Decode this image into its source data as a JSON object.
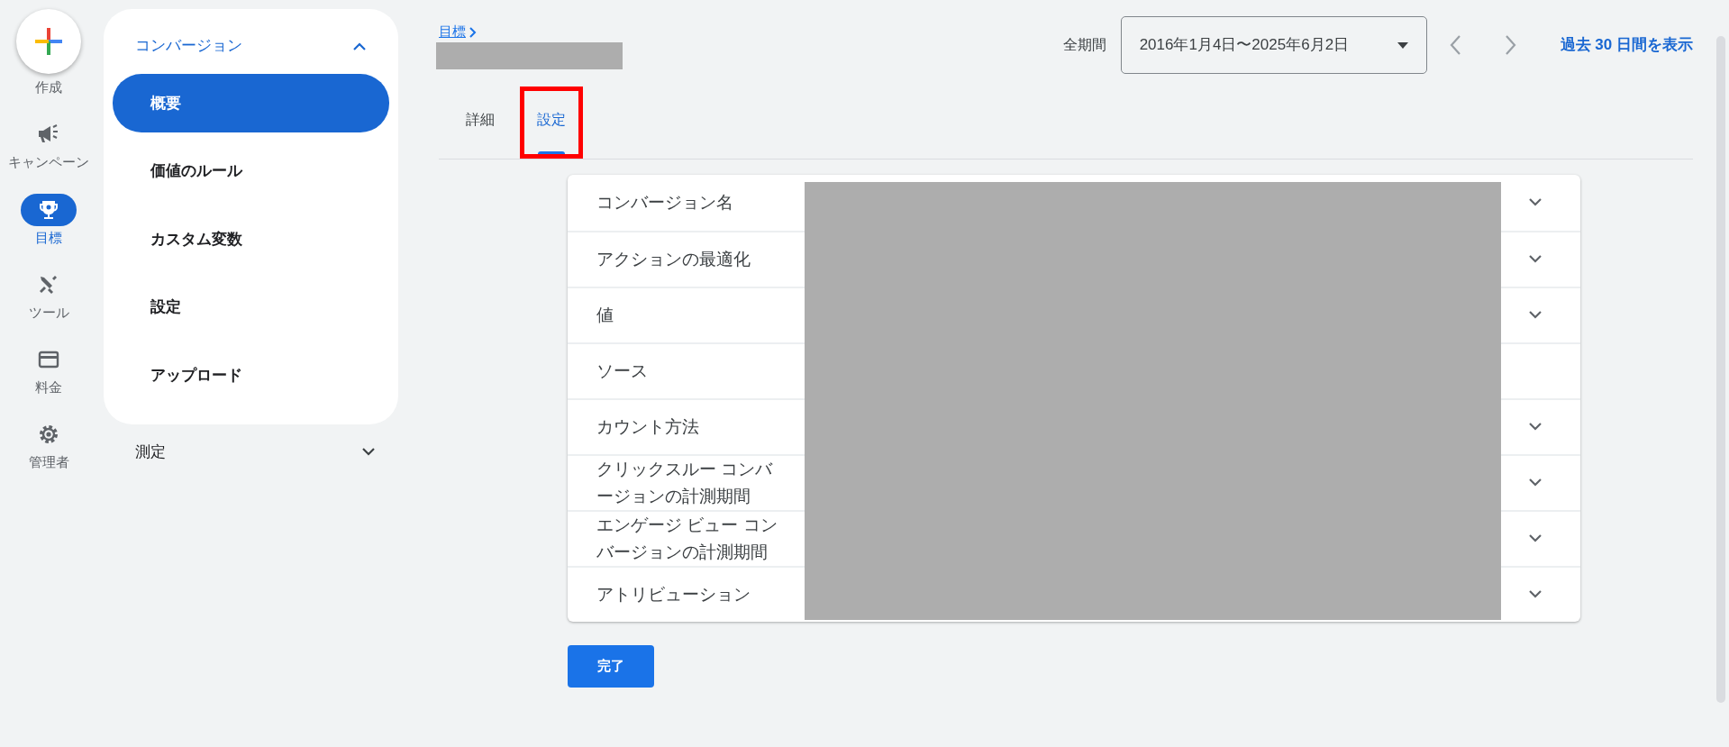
{
  "rail": [
    {
      "kind": "create",
      "label": "作成",
      "selected": false
    },
    {
      "kind": "nav",
      "label": "キャンペーン",
      "selected": false
    },
    {
      "kind": "nav",
      "label": "目標",
      "selected": true
    },
    {
      "kind": "nav",
      "label": "ツール",
      "selected": false
    },
    {
      "kind": "nav",
      "label": "料金",
      "selected": false
    },
    {
      "kind": "nav",
      "label": "管理者",
      "selected": false
    }
  ],
  "sidebar": {
    "sections": [
      {
        "title": "コンバージョン",
        "expanded": true,
        "items": [
          {
            "label": "概要",
            "selected": true
          },
          {
            "label": "価値のルール",
            "selected": false
          },
          {
            "label": "カスタム変数",
            "selected": false
          },
          {
            "label": "設定",
            "selected": false
          },
          {
            "label": "アップロード",
            "selected": false
          }
        ]
      },
      {
        "title": "測定",
        "expanded": false
      }
    ]
  },
  "breadcrumb": "目標",
  "date_range": {
    "label": "全期間",
    "value": "2016年1月4日〜2025年6月2日",
    "link": "過去 30 日間を表示"
  },
  "tabs": [
    {
      "label": "詳細",
      "selected": false,
      "highlighted": false
    },
    {
      "label": "設定",
      "selected": true,
      "highlighted": true
    }
  ],
  "settings": [
    {
      "label": "コンバージョン名",
      "expandable": true
    },
    {
      "label": "アクションの最適化",
      "expandable": true
    },
    {
      "label": "値",
      "expandable": true
    },
    {
      "label": "ソース",
      "expandable": false
    },
    {
      "label": "カウント方法",
      "expandable": true
    },
    {
      "label": "クリックスルー コンバージョンの計測期間",
      "expandable": true
    },
    {
      "label": "エンゲージ ビュー コンバージョンの計測期間",
      "expandable": true
    },
    {
      "label": "アトリビューション",
      "expandable": true
    }
  ],
  "done_button": "完了"
}
